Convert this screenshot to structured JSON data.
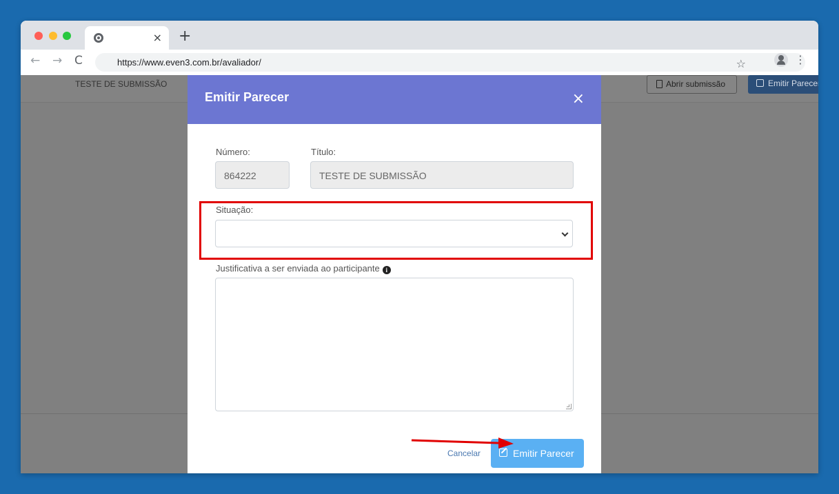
{
  "browser": {
    "url": "https://www.even3.com.br/avaliador/",
    "tab_close": "×",
    "new_tab": "+",
    "back": "←",
    "forward": "→",
    "reload": "C",
    "bookmark": "☆",
    "menu": "⋮"
  },
  "page": {
    "title": "TESTE DE SUBMISSÃO",
    "open_submission_label": "Abrir submissão",
    "emit_review_label": "Emitir Parecer"
  },
  "modal": {
    "title": "Emitir Parecer",
    "close": "×",
    "number_label": "Número:",
    "number_value": "864222",
    "title_label": "Título:",
    "title_value": "TESTE DE SUBMISSÃO",
    "status_label": "Situação:",
    "status_value": "",
    "justification_label": "Justificativa a ser enviada ao participante",
    "info_glyph": "i",
    "justification_value": "",
    "cancel_label": "Cancelar",
    "submit_label": "Emitir Parecer"
  },
  "colors": {
    "modal_header": "#6c76d2",
    "submit_button": "#5ab0f3",
    "highlight": "#e10000",
    "background": "#1a6aae"
  }
}
